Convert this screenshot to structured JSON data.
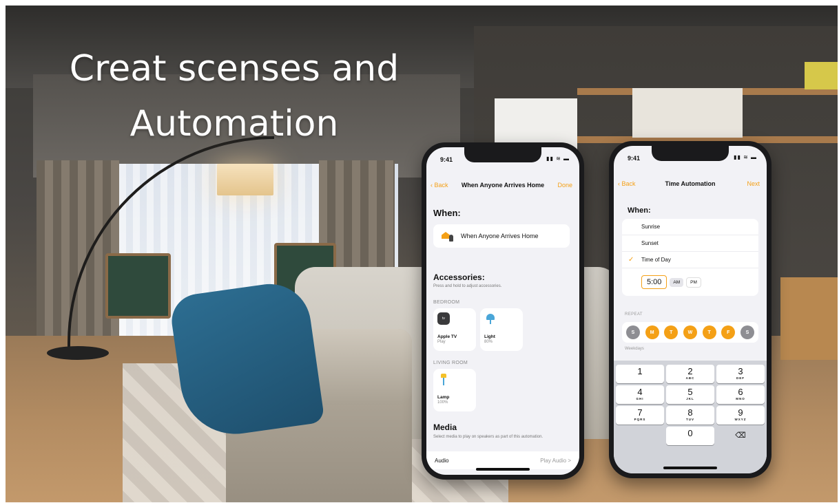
{
  "headline": {
    "line1": "Creat scenses and",
    "line2": "Automation"
  },
  "phone1": {
    "status_time": "9:41",
    "status_icons": "▮▮ ≋ ▬",
    "nav": {
      "back": "Back",
      "title": "When Anyone Arrives Home",
      "right": "Done"
    },
    "when_heading": "When:",
    "when_trigger": "When Anyone Arrives Home",
    "accessories_heading": "Accessories:",
    "accessories_hint": "Press and hold to adjust accessories.",
    "rooms": [
      {
        "name": "BEDROOM",
        "tiles": [
          {
            "name": "Apple TV",
            "status": "Play",
            "icon": "tv-icon"
          },
          {
            "name": "Light",
            "status": "80%",
            "icon": "light-icon"
          }
        ]
      },
      {
        "name": "LIVING ROOM",
        "tiles": [
          {
            "name": "Lamp",
            "status": "100%",
            "icon": "lamp-icon"
          }
        ]
      }
    ],
    "tv_badge": "tv",
    "media_heading": "Media",
    "media_hint": "Select media to play on speakers as part of this automation.",
    "audio": {
      "label": "Audio",
      "value": "Play Audio >"
    }
  },
  "phone2": {
    "status_time": "9:41",
    "status_icons": "▮▮ ≋ ▬",
    "nav": {
      "back": "Back",
      "title": "Time Automation",
      "right": "Next"
    },
    "when_heading": "When:",
    "options": [
      "Sunrise",
      "Sunset",
      "Time of Day"
    ],
    "selected_option": "Time of Day",
    "check_glyph": "✓",
    "time": {
      "value": "5:00",
      "am": "AM",
      "pm": "PM",
      "selected": "PM"
    },
    "repeat_label": "REPEAT",
    "days": [
      {
        "letter": "S",
        "on": false
      },
      {
        "letter": "M",
        "on": true
      },
      {
        "letter": "T",
        "on": true
      },
      {
        "letter": "W",
        "on": true
      },
      {
        "letter": "T",
        "on": true
      },
      {
        "letter": "F",
        "on": true
      },
      {
        "letter": "S",
        "on": false
      }
    ],
    "repeat_summary": "Weekdays",
    "keypad": [
      {
        "num": "1",
        "sub": ""
      },
      {
        "num": "2",
        "sub": "ABC"
      },
      {
        "num": "3",
        "sub": "DEF"
      },
      {
        "num": "4",
        "sub": "GHI"
      },
      {
        "num": "5",
        "sub": "JKL"
      },
      {
        "num": "6",
        "sub": "MNO"
      },
      {
        "num": "7",
        "sub": "PQRS"
      },
      {
        "num": "8",
        "sub": "TUV"
      },
      {
        "num": "9",
        "sub": "WXYZ"
      },
      {
        "num": "",
        "sub": ""
      },
      {
        "num": "0",
        "sub": ""
      },
      {
        "num": "⌫",
        "sub": ""
      }
    ]
  },
  "colors": {
    "accent": "#f4a016",
    "headline": "#ffffff",
    "day_off": "#8e8e93"
  }
}
